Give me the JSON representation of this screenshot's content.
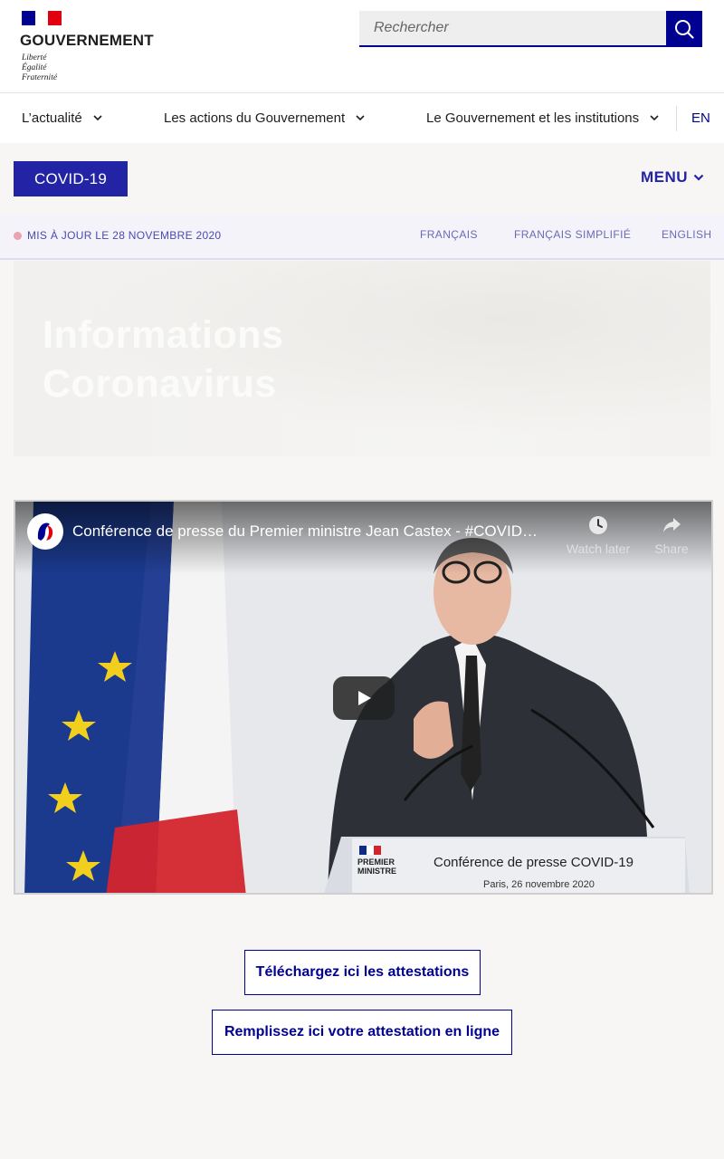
{
  "header": {
    "brand": "GOUVERNEMENT",
    "motto": [
      "Liberté",
      "Égalité",
      "Fraternité"
    ],
    "search_placeholder": "Rechercher",
    "colors": {
      "blue": "#000091",
      "red": "#e1000f"
    }
  },
  "nav": {
    "items": [
      {
        "label": "L’actualité"
      },
      {
        "label": "Les actions du Gouvernement"
      },
      {
        "label": "Le Gouvernement et les institutions"
      }
    ],
    "lang": "EN"
  },
  "covid_bar": {
    "badge": "COVID-19",
    "menu": "MENU"
  },
  "update_bar": {
    "status": "MIS À JOUR LE 28 NOVEMBRE 2020",
    "languages": [
      "FRANÇAIS",
      "FRANÇAIS SIMPLIFIÉ",
      "ENGLISH"
    ]
  },
  "hero": {
    "title_lines": [
      "Informations",
      "Coronavirus"
    ]
  },
  "video": {
    "title": "Conférence de presse du Premier ministre Jean Castex - #COVID…",
    "actions": [
      {
        "label": "Watch later",
        "icon": "clock-icon"
      },
      {
        "label": "Share",
        "icon": "share-icon"
      }
    ],
    "podium": {
      "org": [
        "PREMIER",
        "MINISTRE"
      ],
      "title": "Conférence de presse COVID-19",
      "subtitle": "Paris, 26 novembre 2020"
    }
  },
  "buttons": {
    "download": "Téléchargez ici les attestations",
    "fill": "Remplissez ici votre attestation en ligne"
  }
}
